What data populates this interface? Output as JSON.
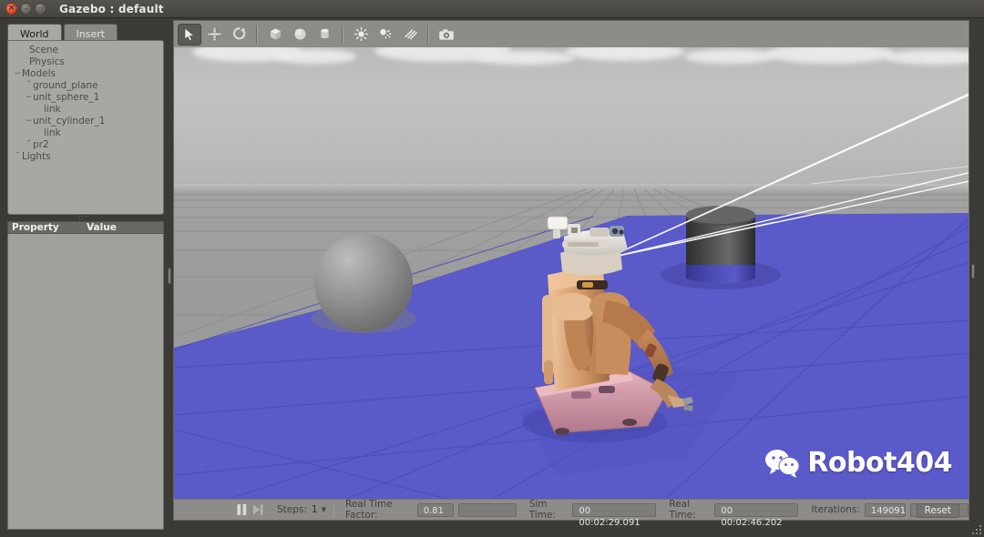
{
  "window": {
    "title": "Gazebo : default",
    "controls": [
      {
        "name": "close",
        "glyph": "×"
      },
      {
        "name": "minimize",
        "glyph": "−"
      },
      {
        "name": "maximize",
        "glyph": "□"
      }
    ]
  },
  "left_panel": {
    "tabs": [
      {
        "label": "World",
        "active": true
      },
      {
        "label": "Insert",
        "active": false
      }
    ],
    "tree": [
      {
        "label": "Scene",
        "depth": 0,
        "twist": ""
      },
      {
        "label": "Physics",
        "depth": 0,
        "twist": ""
      },
      {
        "label": "Models",
        "depth": 1,
        "twist": "−"
      },
      {
        "label": "ground_plane",
        "depth": 2,
        "twist": "ˇ"
      },
      {
        "label": "unit_sphere_1",
        "depth": 2,
        "twist": "−"
      },
      {
        "label": "link",
        "depth": 3,
        "twist": ""
      },
      {
        "label": "unit_cylinder_1",
        "depth": 2,
        "twist": "−"
      },
      {
        "label": "link",
        "depth": 3,
        "twist": ""
      },
      {
        "label": "pr2",
        "depth": 2,
        "twist": "ˇ"
      },
      {
        "label": "Lights",
        "depth": 1,
        "twist": "ˇ"
      }
    ],
    "property_table": {
      "col_property": "Property",
      "col_value": "Value",
      "rows": []
    }
  },
  "toolbar": {
    "items": [
      {
        "icon": "select-arrow-icon",
        "label": "Selection mode",
        "active": true
      },
      {
        "icon": "translate-icon",
        "label": "Translation mode",
        "active": false
      },
      {
        "icon": "rotate-icon",
        "label": "Rotation mode",
        "active": false
      },
      {
        "separator_after": false
      }
    ],
    "groups": [
      [
        "select-arrow-icon",
        "translate-icon",
        "rotate-icon"
      ],
      [
        "box-icon",
        "sphere-icon",
        "cylinder-icon"
      ],
      [
        "point-light-icon",
        "spot-light-icon",
        "directional-light-icon"
      ],
      [
        "screenshot-icon"
      ]
    ]
  },
  "status_bar": {
    "pause_icon": "pause-icon",
    "step_icon": "step-forward-icon",
    "steps_label": "Steps:",
    "steps_value": "1",
    "real_time_factor_label": "Real Time Factor:",
    "real_time_factor_value": "0.81",
    "sim_time_label": "Sim Time:",
    "sim_time_value": "00 00:02:29.091",
    "real_time_label": "Real Time:",
    "real_time_value": "00 00:02:46.202",
    "iterations_label": "Iterations:",
    "iterations_value": "149091",
    "reset_label": "Reset"
  },
  "scene": {
    "watermark_text": "Robot404",
    "watermark_icon": "wechat-icon",
    "objects": [
      {
        "name": "ground-plane",
        "type": "plane",
        "color": "#9c9c9c"
      },
      {
        "name": "unit-sphere-1",
        "type": "sphere",
        "color": "#8e8e8e"
      },
      {
        "name": "unit-cylinder-1",
        "type": "cylinder",
        "color": "#3a3a3a"
      },
      {
        "name": "pr2-robot",
        "type": "robot",
        "color": "#d8a173"
      },
      {
        "name": "laser-overlay",
        "type": "plane",
        "color": "#5a5ac8"
      }
    ],
    "colors": {
      "sky_top": "#bababa",
      "sky_bottom": "#b4b4b4",
      "ground": "#9c9c9c",
      "laser_blue": "#5a5ac8",
      "grid_line": "#8a8a8a",
      "ray_line": "#ffffff",
      "robot_body": "#d8a173",
      "robot_base": "#c98fa3",
      "cylinder": "#3a3a3a",
      "sphere": "#8e8e8e"
    }
  }
}
